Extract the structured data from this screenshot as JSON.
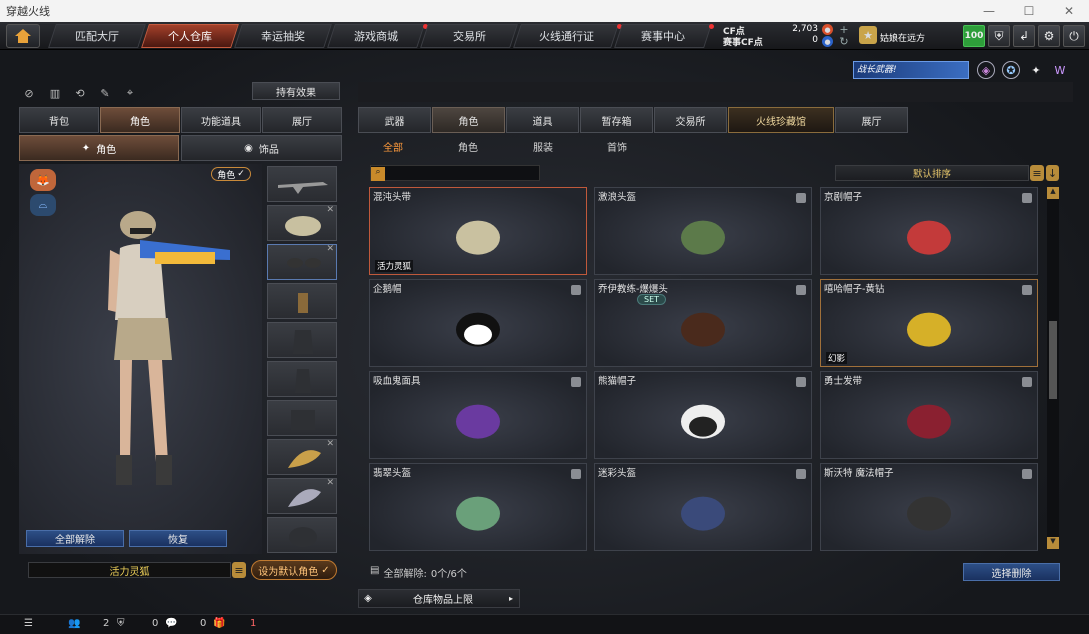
{
  "window": {
    "title": "穿越火线"
  },
  "nav": {
    "tabs": [
      "匹配大厅",
      "个人仓库",
      "幸运抽奖",
      "游戏商城",
      "交易所",
      "火线通行证",
      "赛事中心"
    ],
    "active": 1
  },
  "currency": {
    "cf_label": "CF点",
    "cf_value": "2,703",
    "match_label": "赛事CF点",
    "match_value": "0"
  },
  "player": {
    "status": "姑娘在远方",
    "level": "100"
  },
  "banner": {
    "text": "战长武器!"
  },
  "left": {
    "effect_btn": "持有效果",
    "tabs": [
      "背包",
      "角色",
      "功能道具",
      "展厅"
    ],
    "active_tab": 1,
    "subtabs": [
      "角色",
      "饰品"
    ],
    "active_subtab": 0,
    "role_badge": "角色",
    "unequip_all": "全部解除",
    "restore": "恢复",
    "char_name": "活力灵狐",
    "set_default": "设为默认角色"
  },
  "right": {
    "tabs": [
      "武器",
      "角色",
      "道具",
      "暂存箱",
      "交易所",
      "火线珍藏馆",
      "展厅"
    ],
    "active_tab": 1,
    "subtabs": [
      "全部",
      "角色",
      "服装",
      "首饰"
    ],
    "active_subtab": 0,
    "search_placeholder": "",
    "sort_label": "默认排序",
    "items": [
      {
        "name": "混沌头带",
        "tag": "活力灵狐",
        "icon": "camo-bandana-icon"
      },
      {
        "name": "激浪头盔",
        "tag": "",
        "icon": "green-helmet-icon"
      },
      {
        "name": "京剧帽子",
        "tag": "",
        "icon": "opera-hat-icon"
      },
      {
        "name": "企鹅帽",
        "tag": "",
        "icon": "penguin-hat-icon"
      },
      {
        "name": "乔伊教练-爆爆头",
        "tag": "",
        "set": "SET",
        "icon": "afro-wig-icon"
      },
      {
        "name": "嘻哈帽子-黄钻",
        "tag": "幻影",
        "icon": "gold-cap-icon"
      },
      {
        "name": "吸血鬼面具",
        "tag": "",
        "icon": "vampire-mask-icon"
      },
      {
        "name": "熊猫帽子",
        "tag": "",
        "icon": "panda-hat-icon"
      },
      {
        "name": "勇士发带",
        "tag": "",
        "icon": "warrior-headband-icon"
      },
      {
        "name": "翡翠头盔",
        "tag": "",
        "icon": "jade-helmet-icon"
      },
      {
        "name": "迷彩头盔",
        "tag": "",
        "icon": "camo-helmet-icon"
      },
      {
        "name": "斯沃特 魔法帽子",
        "tag": "",
        "icon": "witch-hat-icon"
      }
    ],
    "unequip_count_label": "全部解除:",
    "unequip_count": "0个/6个",
    "select_delete": "选择删除",
    "storage_limit": "仓库物品上限"
  },
  "bottom": {
    "friends": "2",
    "messages": "0",
    "gifts": "0",
    "alerts": "1"
  }
}
